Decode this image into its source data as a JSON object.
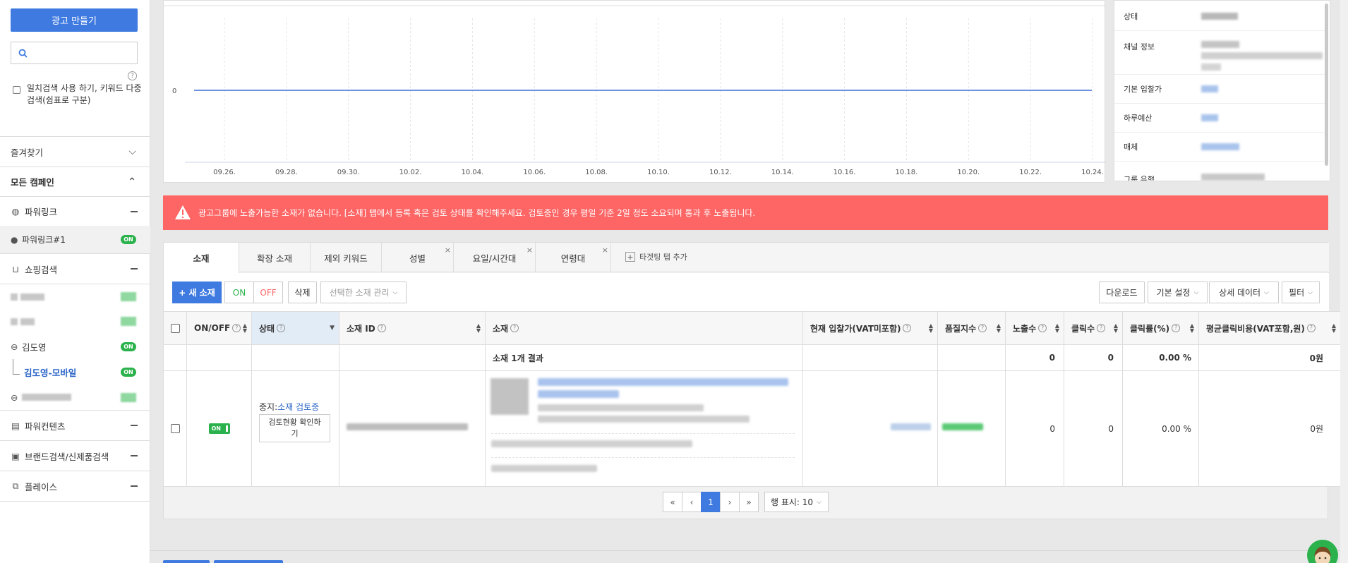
{
  "sidebar": {
    "create_button": "광고 만들기",
    "search_placeholder": "",
    "help": "?",
    "exact_match": "일치검색 사용 하기, 키워드 다중검색(쉼표로 구분)",
    "favorites": "즐겨찾기",
    "all_campaigns": "모든 캠페인",
    "powerlink": "파워링크",
    "powerlink_1": "파워링크#1",
    "shopping": "쇼핑검색",
    "kimdoyoung": "김도영",
    "kimdoyoung_mobile": "김도영-모바일",
    "powercontents": "파워컨텐츠",
    "brand_search": "브랜드검색/신제품검색",
    "place": "플레이스",
    "on_label": "ON"
  },
  "chart": {
    "ytick": "0",
    "xticks": [
      "09.26.",
      "09.28.",
      "09.30.",
      "10.02.",
      "10.04.",
      "10.06.",
      "10.08.",
      "10.10.",
      "10.12.",
      "10.14.",
      "10.16.",
      "10.18.",
      "10.20.",
      "10.22.",
      "10.24."
    ]
  },
  "chart_data": {
    "type": "line",
    "x": [
      "09.26.",
      "09.28.",
      "09.30.",
      "10.02.",
      "10.04.",
      "10.06.",
      "10.08.",
      "10.10.",
      "10.12.",
      "10.14.",
      "10.16.",
      "10.18.",
      "10.20.",
      "10.22.",
      "10.24."
    ],
    "series": [
      {
        "values": [
          0,
          0,
          0,
          0,
          0,
          0,
          0,
          0,
          0,
          0,
          0,
          0,
          0,
          0,
          0
        ]
      }
    ],
    "yticks": [
      0
    ],
    "grid": true
  },
  "info": {
    "status": "상태",
    "channel": "채널 정보",
    "default_bid": "기본 입찰가",
    "daily_budget": "하루예산",
    "media": "매체",
    "group_type": "그룹 유형"
  },
  "alert": {
    "message": "광고그룹에 노출가능한 소재가 없습니다. [소재] 탭에서 등록 혹은 검토 상태를 확인해주세요. 검토중인 경우 평일 기준 2일 정도 소요되며 통과 후 노출됩니다."
  },
  "tabs": {
    "t1": "소재",
    "t2": "확장 소재",
    "t3": "제외 키워드",
    "t4": "성별",
    "t5": "요일/시간대",
    "t6": "연령대",
    "add": "타겟팅 탭 추가",
    "close": "×"
  },
  "toolbar": {
    "new": "+ 새 소재",
    "on": "ON",
    "off": "OFF",
    "delete": "삭제",
    "manage": "선택한 소재 관리",
    "download": "다운로드",
    "default_settings": "기본 설정",
    "detail_data": "상세 데이터",
    "filter": "필터"
  },
  "table": {
    "headers": {
      "onoff": "ON/OFF",
      "status": "상태",
      "id": "소재 ID",
      "creative": "소재",
      "bid": "현재 입찰가(VAT미포함)",
      "quality": "품질지수",
      "impressions": "노출수",
      "clicks": "클릭수",
      "ctr": "클릭률(%)",
      "cpc": "평균클릭비용(VAT포함,원)"
    },
    "summary": {
      "label": "소재 1개 결과",
      "impressions": "0",
      "clicks": "0",
      "ctr": "0.00 %",
      "cpc": "0원"
    },
    "row": {
      "on": "ON",
      "status_prefix": "중지:",
      "status_link": "소재 검토중",
      "review_button": "검토현황 확인하기",
      "impressions": "0",
      "clicks": "0",
      "ctr": "0.00 %",
      "cpc": "0원"
    }
  },
  "pagination": {
    "first": "«",
    "prev": "‹",
    "current": "1",
    "next": "›",
    "last": "»",
    "rows_label": "행 표시: 10"
  },
  "colors": {
    "accent": "#3f7ae0",
    "alert": "#fe6565",
    "on_green": "#2bb24c"
  }
}
